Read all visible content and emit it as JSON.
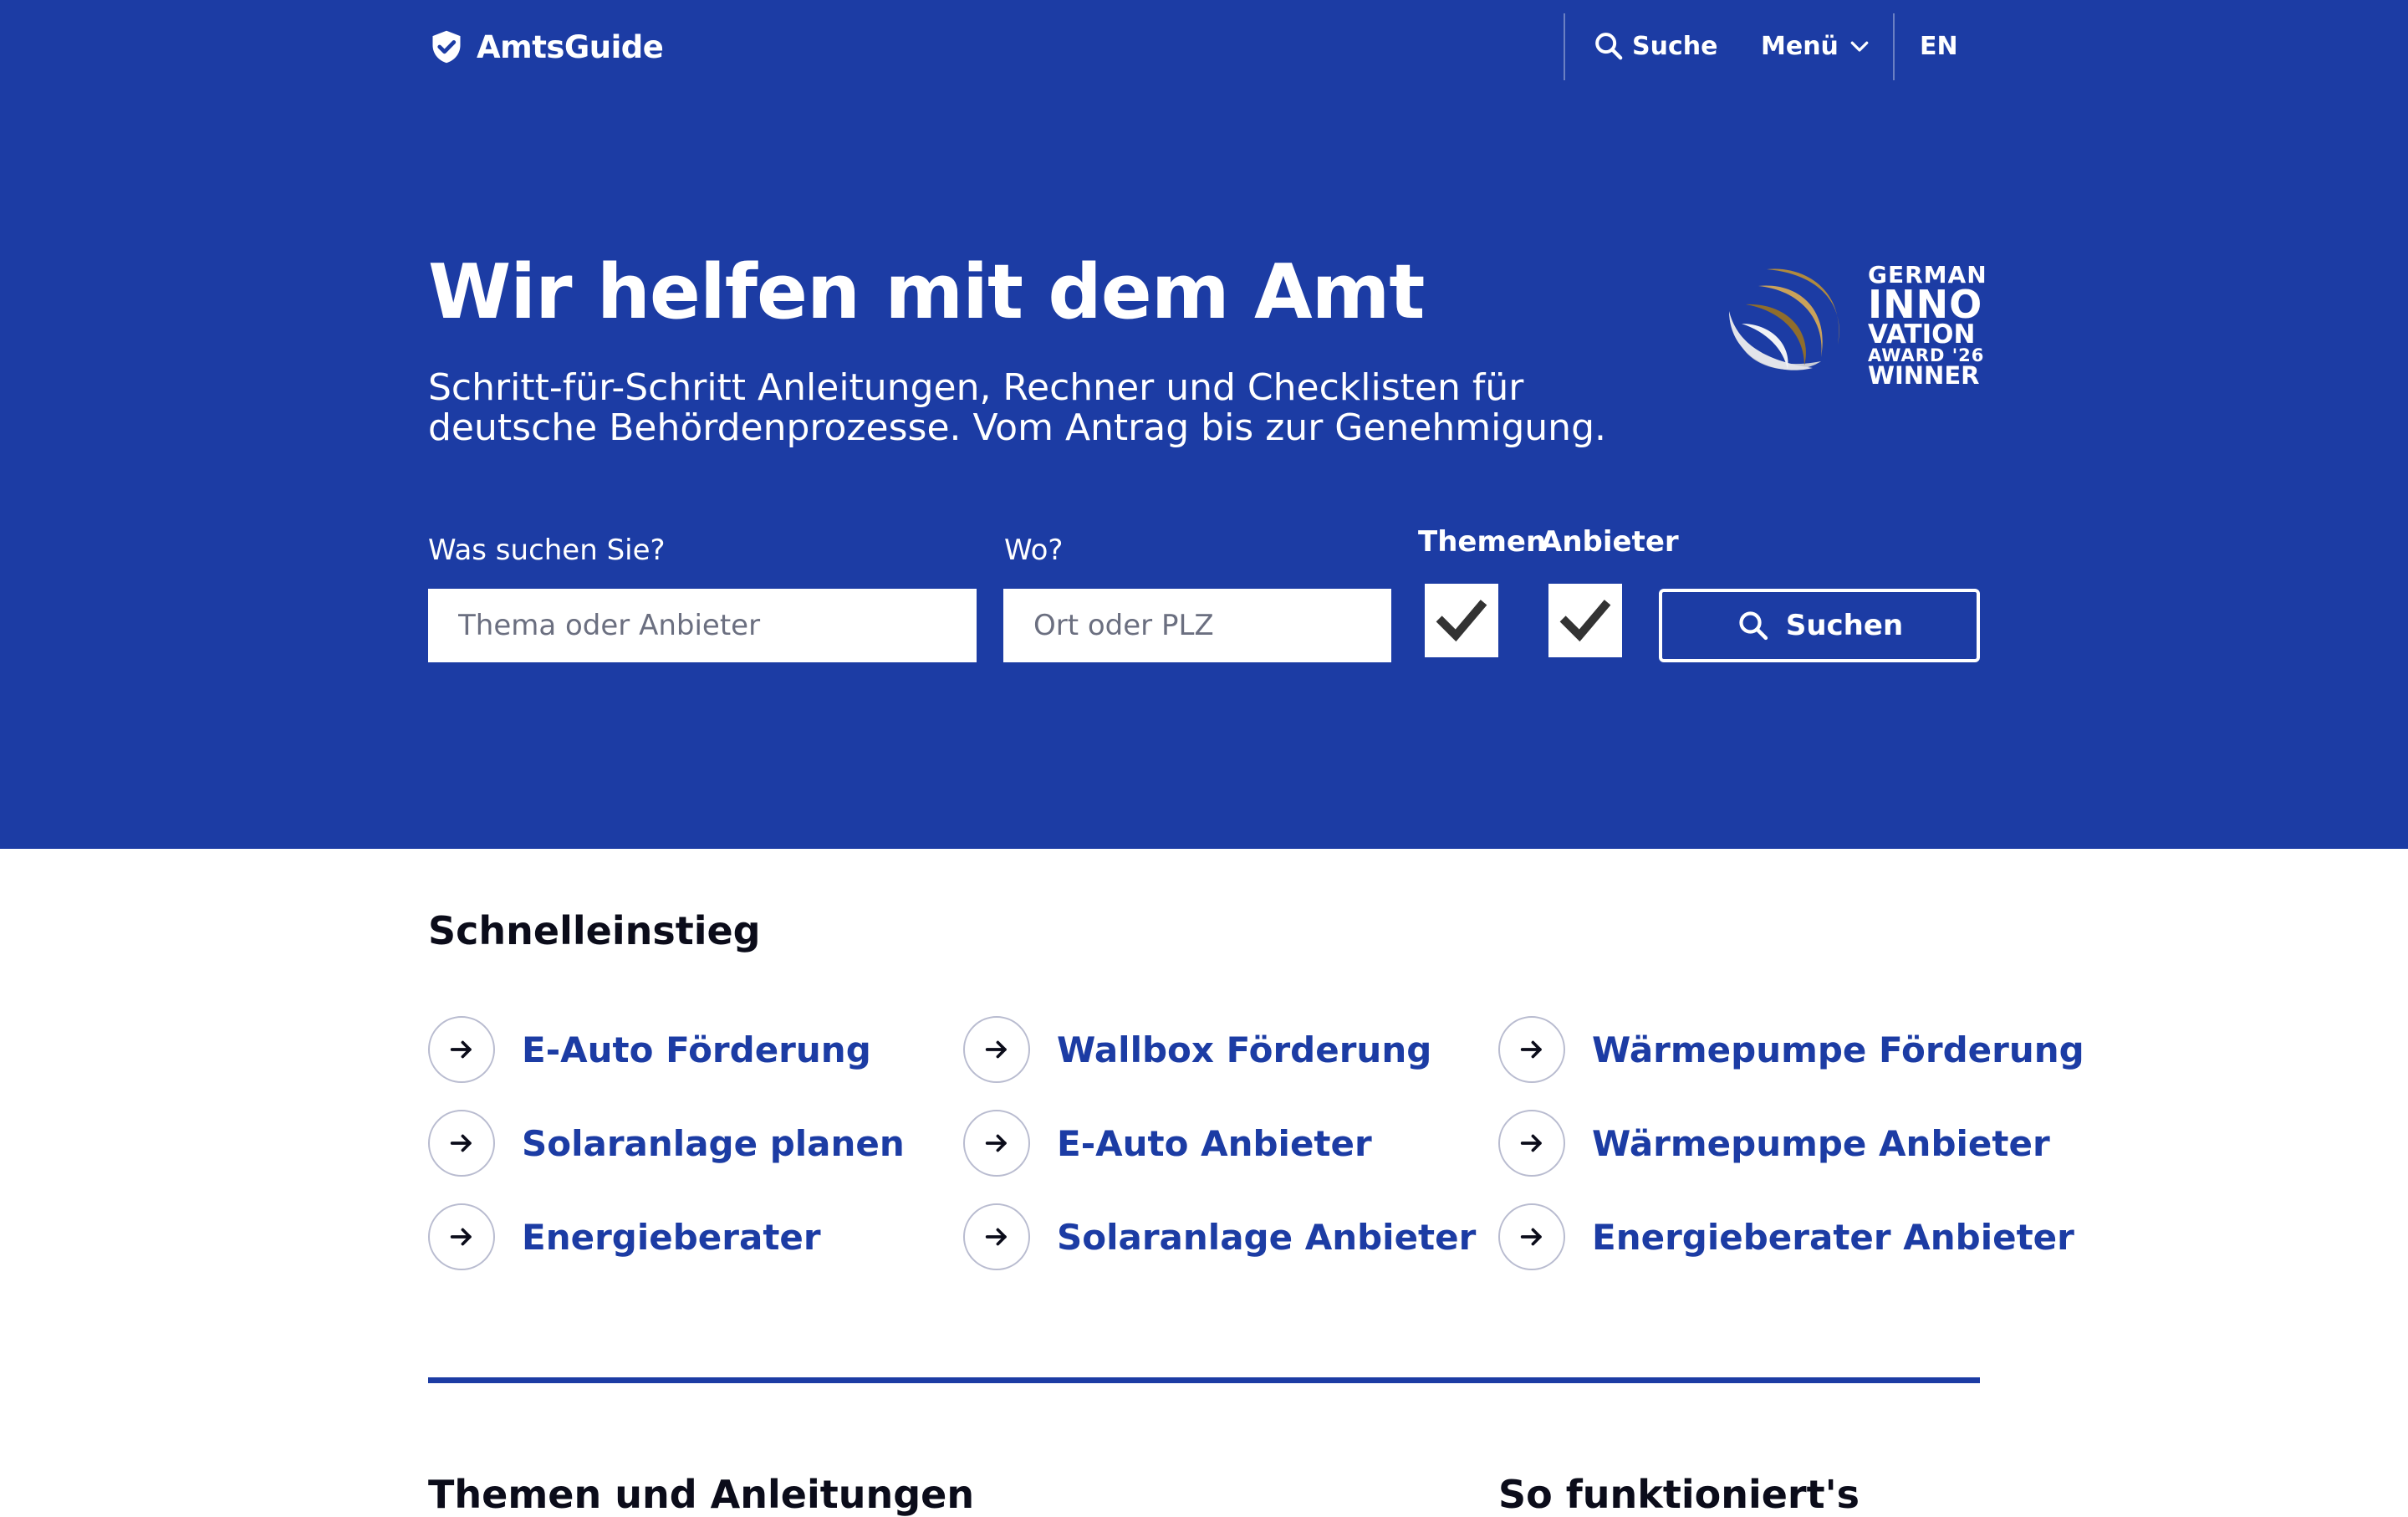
{
  "header": {
    "logo_text": "AmtsGuide",
    "search_label": "Suche",
    "menu_label": "Menü",
    "lang_label": "EN"
  },
  "hero": {
    "headline": "Wir helfen mit dem Amt",
    "subline": "Schritt-für-Schritt Anleitungen, Rechner und Checklisten für deutsche Behördenprozesse. Vom Antrag bis zur Genehmigung.",
    "award_lines": [
      "GERMAN",
      "INNO",
      "VATION",
      "AWARD '26",
      "WINNER"
    ]
  },
  "search": {
    "what_label": "Was suchen Sie?",
    "what_placeholder": "Thema oder Anbieter",
    "where_label": "Wo?",
    "where_placeholder": "Ort oder PLZ",
    "themen_label": "Themen",
    "themen_checked": true,
    "anbieter_label": "Anbieter",
    "anbieter_checked": true,
    "button_label": "Suchen"
  },
  "quick": {
    "title": "Schnelleinstieg",
    "items": [
      "E-Auto Förderung",
      "Wallbox Förderung",
      "Wärmepumpe Förderung",
      "Solaranlage planen",
      "E-Auto Anbieter",
      "Wärmepumpe Anbieter",
      "Energieberater",
      "Solaranlage Anbieter",
      "Energieberater Anbieter"
    ]
  },
  "bottom": {
    "left_title": "Themen und Anleitungen",
    "right_title": "So funktioniert's"
  },
  "colors": {
    "brand": "#1c3ca4",
    "text": "#0b0c1a",
    "white": "#ffffff"
  }
}
